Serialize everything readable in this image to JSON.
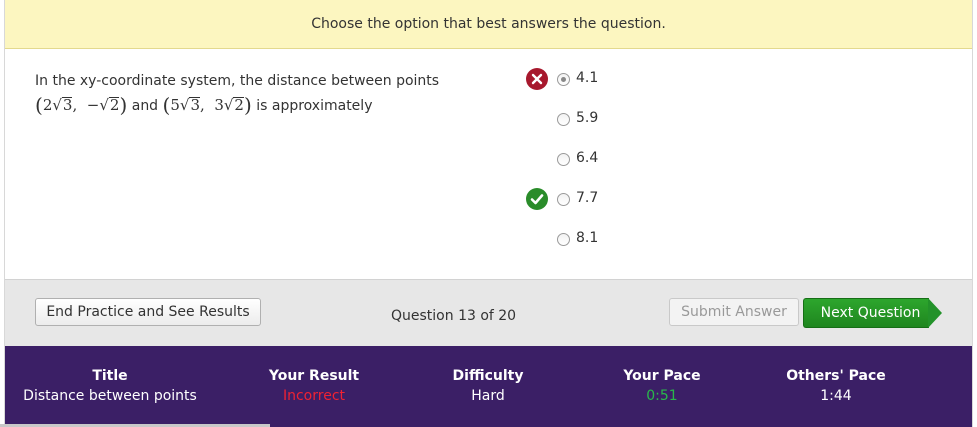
{
  "instruction": "Choose the option that best answers the question.",
  "question": {
    "prefix": "In the xy-coordinate system, the distance between points",
    "point1": {
      "a_coef": "2",
      "a_rad": "3",
      "b_sign": "−",
      "b_coef": "",
      "b_rad": "2"
    },
    "connector": "and",
    "point2": {
      "a_coef": "5",
      "a_rad": "3",
      "b_sign": "",
      "b_coef": "3",
      "b_rad": "2"
    },
    "suffix": "is approximately"
  },
  "options": [
    {
      "label": "4.1",
      "selected": true,
      "mark": "incorrect"
    },
    {
      "label": "5.9",
      "selected": false,
      "mark": ""
    },
    {
      "label": "6.4",
      "selected": false,
      "mark": ""
    },
    {
      "label": "7.7",
      "selected": false,
      "mark": "correct"
    },
    {
      "label": "8.1",
      "selected": false,
      "mark": ""
    }
  ],
  "actions": {
    "end_label": "End Practice and See Results",
    "counter": "Question 13 of 20",
    "submit_label": "Submit Answer",
    "next_label": "Next Question"
  },
  "stats": {
    "title_head": "Title",
    "title_val": "Distance between points",
    "result_head": "Your Result",
    "result_val": "Incorrect",
    "difficulty_head": "Difficulty",
    "difficulty_val": "Hard",
    "pace_head": "Your Pace",
    "pace_val": "0:51",
    "others_head": "Others' Pace",
    "others_val": "1:44"
  },
  "colors": {
    "instruction_bg": "#fcf6c0",
    "stats_bg": "#3b1f66",
    "next_button": "#23922a",
    "incorrect": "#ee2233",
    "pace": "#29b84a"
  },
  "icons": {
    "incorrect": "x-circle-icon",
    "correct": "check-circle-icon"
  }
}
